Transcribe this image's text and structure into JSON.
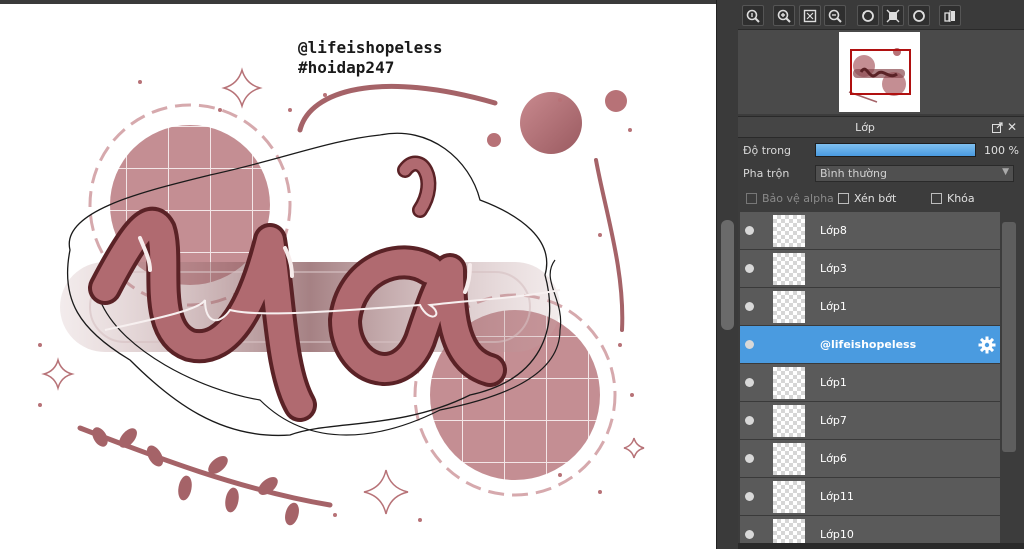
{
  "canvas": {
    "artwork_text": {
      "username": "@lifeishopeless",
      "hashtag": "#hoidap247"
    },
    "colors": {
      "rose": "#a56368",
      "rose_light": "#c48e93",
      "rose_dark": "#5a2226",
      "line": "#1a1a1a"
    }
  },
  "toolbar": {
    "buttons": [
      {
        "name": "zoom-reset-icon"
      },
      {
        "name": "zoom-in-icon"
      },
      {
        "name": "fit-screen-icon"
      },
      {
        "name": "zoom-out-icon"
      },
      {
        "name": "rotate-left-icon"
      },
      {
        "name": "reset-view-icon"
      },
      {
        "name": "rotate-right-icon"
      },
      {
        "name": "flip-icon"
      }
    ]
  },
  "layer_panel": {
    "title": "Lớp",
    "opacity_label": "Độ trong",
    "opacity_value": "100 %",
    "opacity_fraction": 1.0,
    "blend_label": "Pha trộn",
    "blend_value": "Bình thường",
    "protect_alpha": "Bảo vệ alpha",
    "clipping": "Xén bớt",
    "lock": "Khóa",
    "layers": [
      {
        "name": "Lớp8",
        "selected": false
      },
      {
        "name": "Lớp3",
        "selected": false
      },
      {
        "name": "Lớp1",
        "selected": false
      },
      {
        "name": "@lifeishopeless",
        "selected": true
      },
      {
        "name": "Lớp1",
        "selected": false
      },
      {
        "name": "Lớp7",
        "selected": false
      },
      {
        "name": "Lớp6",
        "selected": false
      },
      {
        "name": "Lớp11",
        "selected": false
      },
      {
        "name": "Lớp10",
        "selected": false
      }
    ]
  }
}
